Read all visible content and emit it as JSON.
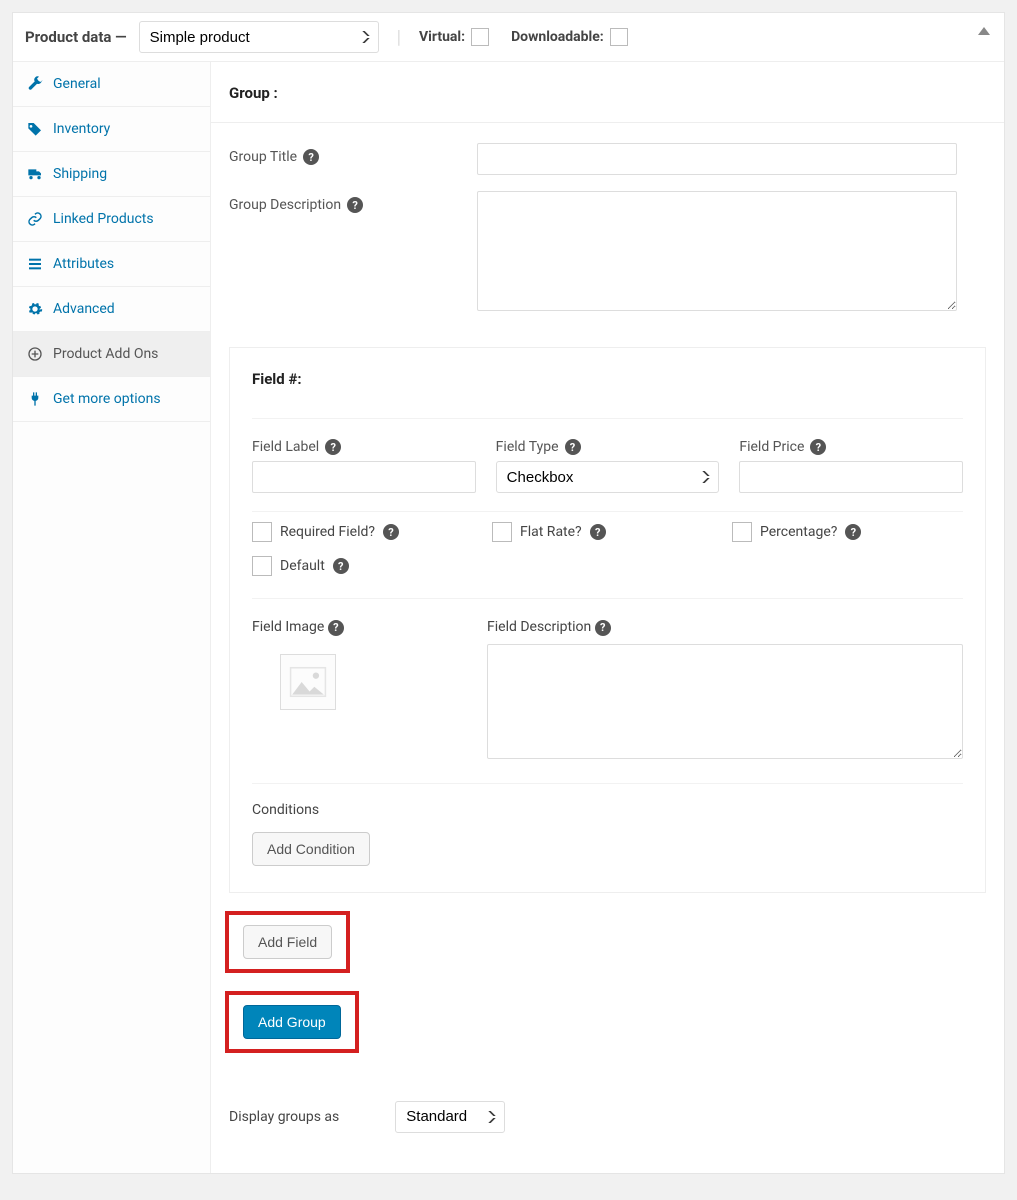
{
  "header": {
    "title": "Product data —",
    "product_type": "Simple product",
    "virtual_label": "Virtual:",
    "downloadable_label": "Downloadable:"
  },
  "sidebar": {
    "items": [
      {
        "label": "General",
        "icon": "wrench"
      },
      {
        "label": "Inventory",
        "icon": "tag"
      },
      {
        "label": "Shipping",
        "icon": "truck"
      },
      {
        "label": "Linked Products",
        "icon": "link"
      },
      {
        "label": "Attributes",
        "icon": "list"
      },
      {
        "label": "Advanced",
        "icon": "gear"
      },
      {
        "label": "Product Add Ons",
        "icon": "plus-circle"
      },
      {
        "label": "Get more options",
        "icon": "plug"
      }
    ]
  },
  "group": {
    "heading": "Group :",
    "title_label": "Group Title",
    "desc_label": "Group Description"
  },
  "field": {
    "heading": "Field #:",
    "label_label": "Field Label",
    "type_label": "Field Type",
    "type_value": "Checkbox",
    "price_label": "Field Price",
    "required_label": "Required Field?",
    "flatrate_label": "Flat Rate?",
    "percentage_label": "Percentage?",
    "default_label": "Default",
    "image_label": "Field Image",
    "description_label": "Field Description",
    "conditions_label": "Conditions",
    "add_condition_btn": "Add Condition"
  },
  "actions": {
    "add_field": "Add Field",
    "add_group": "Add Group"
  },
  "display": {
    "label": "Display groups as",
    "value": "Standard"
  }
}
